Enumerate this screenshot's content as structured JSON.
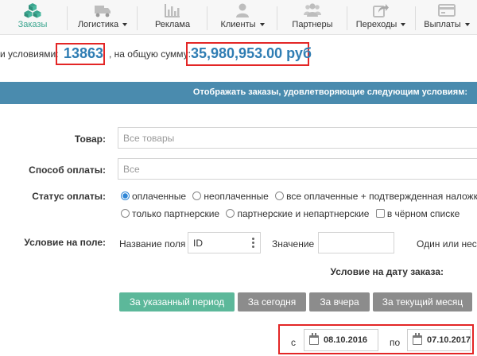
{
  "nav": {
    "items": [
      {
        "label": "Заказы",
        "icon": "cubes-icon",
        "dropdown": false,
        "active": true
      },
      {
        "label": "Логистика",
        "icon": "truck-icon",
        "dropdown": true
      },
      {
        "label": "Реклама",
        "icon": "bar-chart-icon",
        "dropdown": false
      },
      {
        "label": "Клиенты",
        "icon": "user-icon",
        "dropdown": true
      },
      {
        "label": "Партнеры",
        "icon": "users-icon",
        "dropdown": false
      },
      {
        "label": "Переходы",
        "icon": "share-icon",
        "dropdown": true
      },
      {
        "label": "Выплаты",
        "icon": "credit-card-icon",
        "dropdown": true
      }
    ],
    "accent": "#3aa58f"
  },
  "summary": {
    "prefix": "и условиями:",
    "count": "13863",
    "middle": ", на общую сумму:",
    "total": "35,980,953.00 руб"
  },
  "filter_bar": {
    "title": "Отображать заказы, удовлетворяющие следующим условиям:"
  },
  "form": {
    "product_label": "Товар:",
    "product_value": "Все товары",
    "payment_method_label": "Способ оплаты:",
    "payment_method_value": "Все",
    "payment_status_label": "Статус оплаты:",
    "payment_status_options": [
      "оплаченные",
      "неоплаченные",
      "все оплаченные + подтвержденная наложка",
      "только партнерские",
      "партнерские и непартнерские"
    ],
    "blacklist_label": "в чёрном списке",
    "field_condition_label": "Условие на поле:",
    "field_name_label": "Название поля",
    "field_name_value": "ID",
    "value_label": "Значение",
    "value_value": "",
    "one_or_more_label": "Один или нес",
    "date_condition_label": "Условие на дату заказа:",
    "period_buttons": [
      "За указанный период",
      "За сегодня",
      "За вчера",
      "За текущий месяц"
    ],
    "from_label": "с",
    "from_date": "08.10.2016",
    "to_label": "по",
    "to_date": "07.10.2017"
  },
  "colors": {
    "highlight_border": "#e32626",
    "number_blue": "#2f7db3",
    "bar_blue": "#4a8bae",
    "button_green": "#5cb89a",
    "button_gray": "#8c8c8c"
  }
}
